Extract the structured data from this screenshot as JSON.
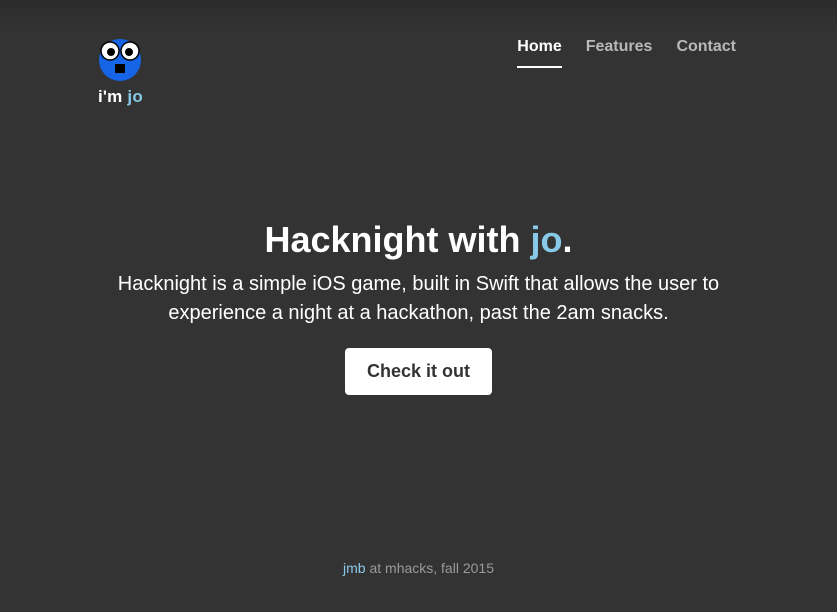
{
  "brand": {
    "prefix": "i'm ",
    "name": "jo",
    "logo_icon": "googly-eyed-face-icon"
  },
  "nav": {
    "items": [
      {
        "label": "Home",
        "active": true
      },
      {
        "label": "Features",
        "active": false
      },
      {
        "label": "Contact",
        "active": false
      }
    ]
  },
  "hero": {
    "title_prefix": "Hacknight with ",
    "title_accent": "jo",
    "title_suffix": ".",
    "lead": "Hacknight is a simple iOS game, built in Swift that allows the user to experience a night at a hackathon, past the 2am snacks.",
    "button_label": "Check it out"
  },
  "footer": {
    "author_link": "jmb",
    "text": " at mhacks, fall 2015"
  },
  "colors": {
    "background": "#333333",
    "accent": "#88c9e8",
    "logo_blue": "#1565e6",
    "button_bg": "#ffffff"
  }
}
